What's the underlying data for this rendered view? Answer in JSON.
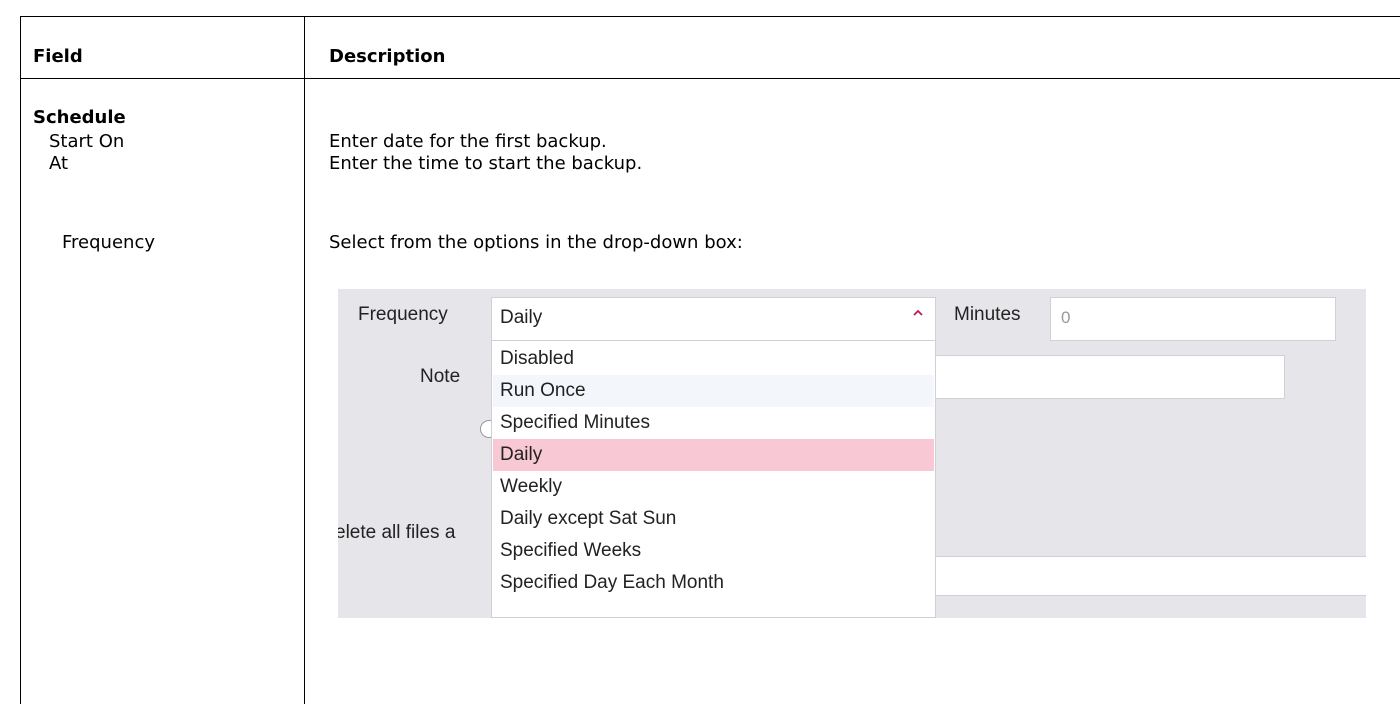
{
  "table": {
    "headers": {
      "field": "Field",
      "description": "Description"
    },
    "section_title": "Schedule",
    "rows": [
      {
        "field": "Start On",
        "description": "Enter date for the first backup."
      },
      {
        "field": "At",
        "description": "Enter the time to start the backup."
      },
      {
        "field": "Frequency",
        "description": "Select from the options in the drop-down box:"
      }
    ]
  },
  "screenshot": {
    "frequency_label": "Frequency",
    "frequency_value": "Daily",
    "minutes_label": "Minutes",
    "minutes_value": "0",
    "note_label": "Note",
    "delete_label_fragment": "elete all files a",
    "options": [
      "Disabled",
      "Run Once",
      "Specified Minutes",
      "Daily",
      "Weekly",
      "Daily except Sat Sun",
      "Specified Weeks",
      "Specified Day Each Month"
    ],
    "selected_option": "Daily",
    "colors": {
      "background": "#e6e6ea",
      "selected_highlight": "#f8c8d4",
      "chevron": "#c2185b"
    },
    "icons": {
      "dropdown": "chevron-up-icon"
    }
  }
}
